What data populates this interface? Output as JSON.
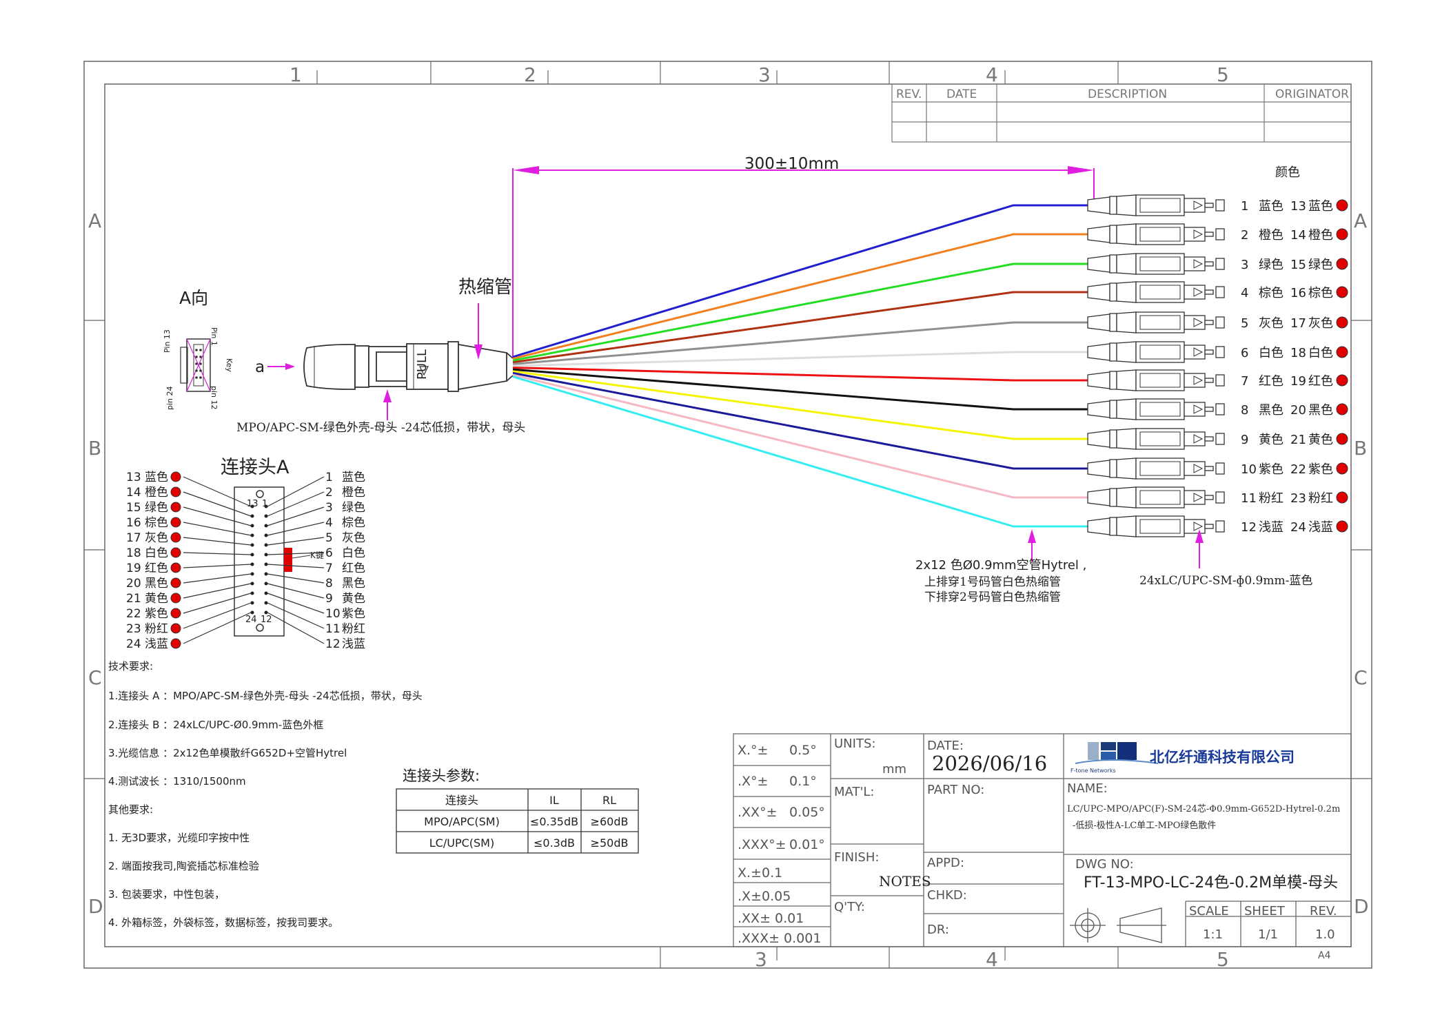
{
  "frame": {
    "cols_top": [
      "1",
      "2",
      "3",
      "4",
      "5"
    ],
    "cols_bottom": [
      "3",
      "4",
      "5"
    ],
    "rows_left": [
      "A",
      "B",
      "C",
      "D"
    ],
    "rows_right": [
      "A",
      "B",
      "C",
      "D"
    ]
  },
  "revision_block": {
    "headers": [
      "REV.",
      "DATE",
      "DESCRIPTION",
      "ORIGINATOR"
    ]
  },
  "dimension": {
    "length": "300±10mm"
  },
  "labels": {
    "view_a": "A向",
    "arrow_a": "a",
    "heat_shrink": "热缩管",
    "mpo_desc": "MPO/APC-SM-绿色外壳-母头 -24芯低损，带状，母头",
    "pull": "PULL",
    "connector_a": "连接头A",
    "pin13": "Pin 13",
    "pin1": "Pin 1",
    "pin24": "pin 24",
    "pin12": "pin 12",
    "key": "Key",
    "k_key": "K键",
    "face_13": "13",
    "face_1": "1",
    "face_24": "24",
    "face_12": "12",
    "color_header": "颜色",
    "cable_note_1": "2x12 色Ø0.9mm空管Hytrel ,",
    "cable_note_2": "上排穿1号码管白色热缩管",
    "cable_note_3": "下排穿2号码管白色热缩管",
    "lc_desc": "24xLC/UPC-SM-ɸ0.9mm-蓝色"
  },
  "fibers": [
    {
      "a": "1",
      "a_name": "蓝色",
      "b": "13",
      "b_name": "蓝色",
      "color": "#1f1fd0"
    },
    {
      "a": "2",
      "a_name": "橙色",
      "b": "14",
      "b_name": "橙色",
      "color": "#f08020"
    },
    {
      "a": "3",
      "a_name": "绿色",
      "b": "15",
      "b_name": "绿色",
      "color": "#22dd22"
    },
    {
      "a": "4",
      "a_name": "棕色",
      "b": "16",
      "b_name": "棕色",
      "color": "#b03010"
    },
    {
      "a": "5",
      "a_name": "灰色",
      "b": "17",
      "b_name": "灰色",
      "color": "#909090"
    },
    {
      "a": "6",
      "a_name": "白色",
      "b": "18",
      "b_name": "白色",
      "color": "#dcdcdc"
    },
    {
      "a": "7",
      "a_name": "红色",
      "b": "19",
      "b_name": "红色",
      "color": "#ee1111"
    },
    {
      "a": "8",
      "a_name": "黑色",
      "b": "20",
      "b_name": "黑色",
      "color": "#111111"
    },
    {
      "a": "9",
      "a_name": "黄色",
      "b": "21",
      "b_name": "黄色",
      "color": "#f4f400"
    },
    {
      "a": "10",
      "a_name": "紫色",
      "b": "22",
      "b_name": "紫色",
      "color": "#1a1a9a"
    },
    {
      "a": "11",
      "a_name": "粉红",
      "b": "23",
      "b_name": "粉红",
      "color": "#f5b8c4"
    },
    {
      "a": "12",
      "a_name": "浅蓝",
      "b": "24",
      "b_name": "浅蓝",
      "color": "#33eeee"
    }
  ],
  "pinout_left": [
    {
      "num": "13",
      "name": "蓝色"
    },
    {
      "num": "14",
      "name": "橙色"
    },
    {
      "num": "15",
      "name": "绿色"
    },
    {
      "num": "16",
      "name": "棕色"
    },
    {
      "num": "17",
      "name": "灰色"
    },
    {
      "num": "18",
      "name": "白色"
    },
    {
      "num": "19",
      "name": "红色"
    },
    {
      "num": "20",
      "name": "黑色"
    },
    {
      "num": "21",
      "name": "黄色"
    },
    {
      "num": "22",
      "name": "紫色"
    },
    {
      "num": "23",
      "name": "粉红"
    },
    {
      "num": "24",
      "name": "浅蓝"
    }
  ],
  "pinout_right": [
    {
      "num": "1",
      "name": "蓝色"
    },
    {
      "num": "2",
      "name": "橙色"
    },
    {
      "num": "3",
      "name": "绿色"
    },
    {
      "num": "4",
      "name": "棕色"
    },
    {
      "num": "5",
      "name": "灰色"
    },
    {
      "num": "6",
      "name": "白色"
    },
    {
      "num": "7",
      "name": "红色"
    },
    {
      "num": "8",
      "name": "黑色"
    },
    {
      "num": "9",
      "name": "黄色"
    },
    {
      "num": "10",
      "name": "紫色"
    },
    {
      "num": "11",
      "name": "粉红"
    },
    {
      "num": "12",
      "name": "浅蓝"
    }
  ],
  "tech": {
    "title": "技术要求:",
    "items": [
      "1.连接头 A ：MPO/APC-SM-绿色外壳-母头 -24芯低损，带状，母头",
      "2.连接头 B ：24xLC/UPC-Ø0.9mm-蓝色外框",
      "3.光缆信息 ：2x12色单模散纤G652D+空管Hytrel",
      "4.测试波长 ：1310/1500nm"
    ],
    "other_title": "其他要求:",
    "other_items": [
      "1. 无3D要求，光缆印字按中性",
      "2. 端面按我司,陶瓷插芯标准检验",
      "3. 包装要求，中性包装，",
      "4. 外箱标签，外袋标签，数据标签，按我司要求。"
    ]
  },
  "params": {
    "title": "连接头参数:",
    "headers": [
      "连接头",
      "IL",
      "RL"
    ],
    "rows": [
      [
        "MPO/APC(SM)",
        "≤0.35dB",
        "≥60dB"
      ],
      [
        "LC/UPC(SM)",
        "≤0.3dB",
        "≥50dB"
      ]
    ]
  },
  "title_block": {
    "tol": [
      [
        "X.°±",
        "0.5°"
      ],
      [
        ".X°±",
        "0.1°"
      ],
      [
        ".XX°±",
        "0.05°"
      ],
      [
        ".XXX°±",
        "0.01°"
      ],
      [
        "X.±0.1",
        ""
      ],
      [
        ".X±0.05",
        ""
      ],
      [
        ".XX± 0.01",
        ""
      ],
      [
        ".XXX± 0.001",
        ""
      ]
    ],
    "units_label": "UNITS:",
    "units_value": "mm",
    "matl_label": "MAT'L:",
    "finish_label": "FINISH:",
    "finish_value": "NOTES",
    "qty_label": "Q'TY:",
    "date_label": "DATE:",
    "date_value": "2026/06/16",
    "part_no_label": "PART NO:",
    "appd_label": "APPD:",
    "chkd_label": "CHKD:",
    "dr_label": "DR:",
    "company": "北亿纤通科技有限公司",
    "logo_sub": "F-tone Networks",
    "name_label": "NAME:",
    "name_line1": "LC/UPC-MPO/APC(F)-SM-24芯-Φ0.9mm-G652D-Hytrel-0.2m",
    "name_line2": "-低损-极性A-LC单工-MPO绿色散件",
    "dwg_label": "DWG NO:",
    "dwg_value": "FT-13-MPO-LC-24色-0.2M单模-母头",
    "scale_label": "SCALE",
    "scale_value": "1:1",
    "sheet_label": "SHEET",
    "sheet_value": "1/1",
    "rev_label": "REV.",
    "rev_value": "1.0",
    "paper": "A4"
  },
  "colors": {
    "dimension": "#e01ee0",
    "line": "#333333",
    "dot": "#e00000"
  }
}
